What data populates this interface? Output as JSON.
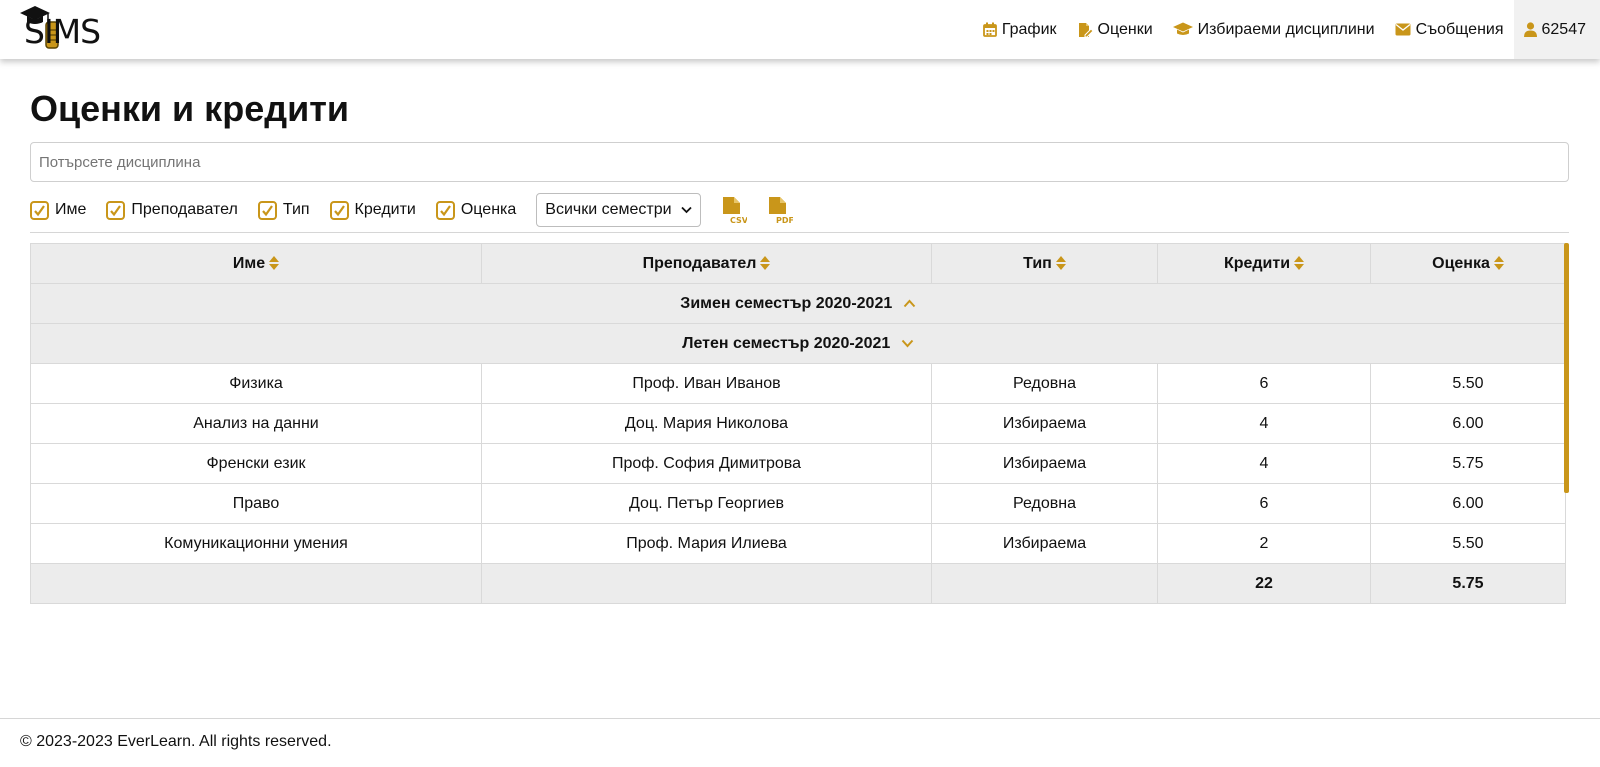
{
  "header": {
    "logo_text": "SIMS",
    "nav": [
      {
        "label": "График",
        "icon": "calendar-icon"
      },
      {
        "label": "Оценки",
        "icon": "file-edit-icon"
      },
      {
        "label": "Избираеми дисциплини",
        "icon": "graduation-cap-icon"
      },
      {
        "label": "Съобщения",
        "icon": "envelope-icon"
      },
      {
        "label": "62547",
        "icon": "user-icon"
      }
    ]
  },
  "main": {
    "title": "Оценки и кредити",
    "search_placeholder": "Потърсете дисциплина",
    "filters": [
      {
        "label": "Име",
        "checked": true
      },
      {
        "label": "Преподавател",
        "checked": true
      },
      {
        "label": "Тип",
        "checked": true
      },
      {
        "label": "Кредити",
        "checked": true
      },
      {
        "label": "Оценка",
        "checked": true
      }
    ],
    "semester_select": "Всички семестри",
    "export_icons": [
      "csv-file-icon",
      "pdf-file-icon"
    ]
  },
  "table": {
    "headers": [
      "Име",
      "Преподавател",
      "Тип",
      "Кредити",
      "Оценка"
    ],
    "semesters": [
      {
        "label": "Зимен семестър 2020-2021",
        "expanded": false
      },
      {
        "label": "Летен семестър 2020-2021",
        "expanded": true
      }
    ],
    "rows": [
      [
        "Физика",
        "Проф. Иван Иванов",
        "Редовна",
        "6",
        "5.50"
      ],
      [
        "Анализ на данни",
        "Доц. Мария Николова",
        "Избираема",
        "4",
        "6.00"
      ],
      [
        "Френски език",
        "Проф. София Димитрова",
        "Избираема",
        "4",
        "5.75"
      ],
      [
        "Право",
        "Доц. Петър Георгиев",
        "Редовна",
        "6",
        "6.00"
      ],
      [
        "Комуникационни умения",
        "Проф. Мария Илиева",
        "Избираема",
        "2",
        "5.50"
      ]
    ],
    "totals": [
      "",
      "",
      "",
      "22",
      "5.75"
    ]
  },
  "footer": {
    "text": "© 2023-2023 EverLearn. All rights reserved."
  },
  "colors": {
    "accent": "#c9961a"
  }
}
